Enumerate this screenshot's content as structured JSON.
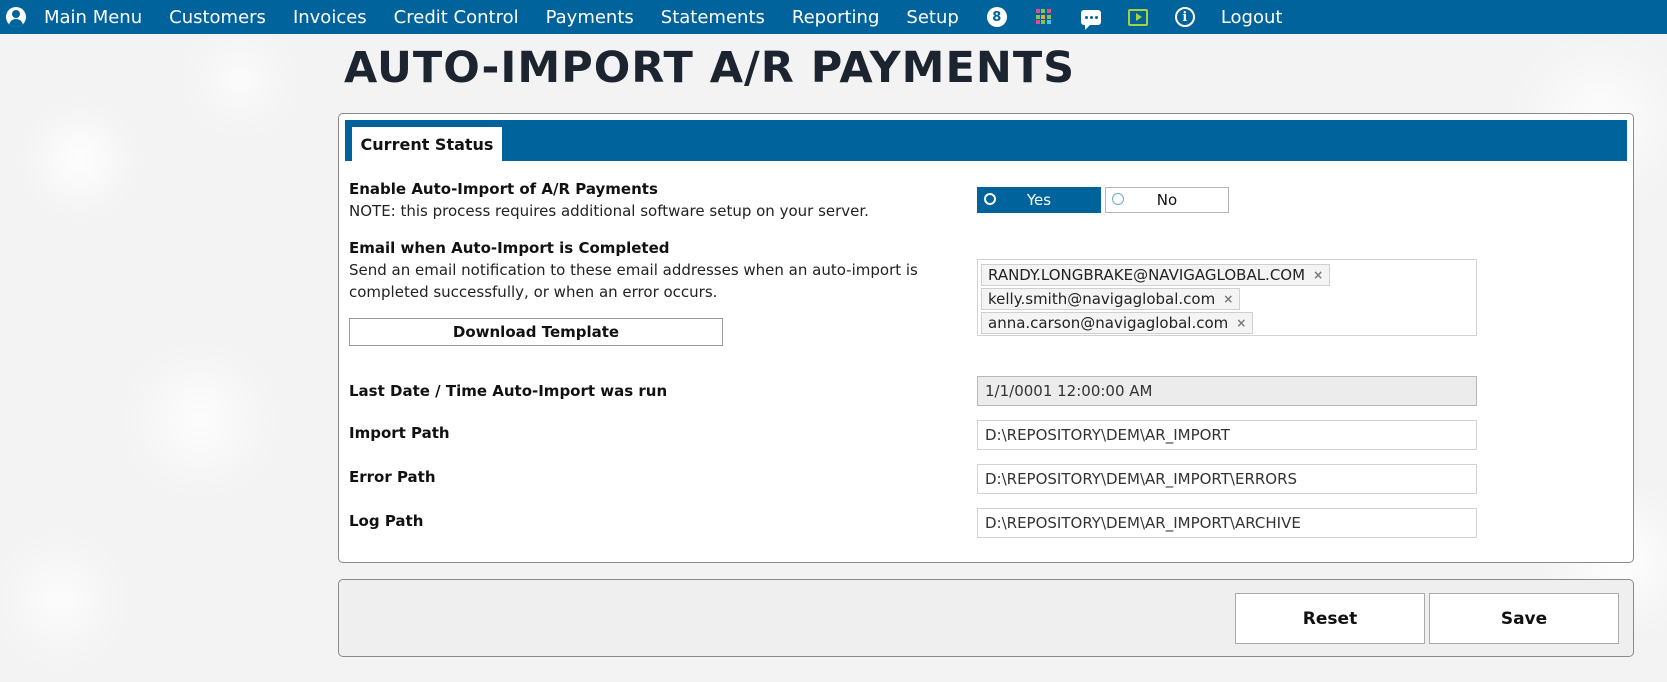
{
  "nav": {
    "items": [
      "Main Menu",
      "Customers",
      "Invoices",
      "Credit Control",
      "Payments",
      "Statements",
      "Reporting",
      "Setup"
    ],
    "notification_count": "8",
    "logout_label": "Logout",
    "colors": {
      "bar": "#00639b",
      "tv_icon": "#a7d23b"
    }
  },
  "page": {
    "title": "AUTO-IMPORT A/R PAYMENTS"
  },
  "tab": {
    "label": "Current Status"
  },
  "enable": {
    "label": "Enable Auto-Import of A/R Payments",
    "note": "NOTE: this process requires additional software setup on your server.",
    "yes_label": "Yes",
    "no_label": "No",
    "selected": "Yes"
  },
  "email": {
    "label": "Email when Auto-Import is Completed",
    "description": "Send an email notification to these email addresses when an auto-import is completed successfully, or when an error occurs.",
    "addresses": [
      "RANDY.LONGBRAKE@NAVIGAGLOBAL.COM",
      "kelly.smith@navigaglobal.com",
      "anna.carson@navigaglobal.com"
    ],
    "remove_symbol": "×"
  },
  "download_template_label": "Download Template",
  "last_run": {
    "label": "Last Date / Time Auto-Import was run",
    "value": "1/1/0001 12:00:00 AM"
  },
  "import_path": {
    "label": "Import Path",
    "value": "D:\\REPOSITORY\\DEM\\AR_IMPORT"
  },
  "error_path": {
    "label": "Error Path",
    "value": "D:\\REPOSITORY\\DEM\\AR_IMPORT\\ERRORS"
  },
  "log_path": {
    "label": "Log Path",
    "value": "D:\\REPOSITORY\\DEM\\AR_IMPORT\\ARCHIVE"
  },
  "actions": {
    "reset_label": "Reset",
    "save_label": "Save"
  }
}
